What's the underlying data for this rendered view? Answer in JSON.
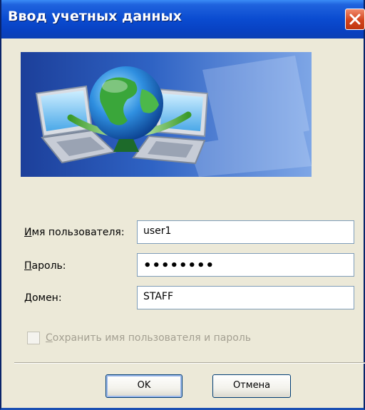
{
  "window": {
    "title": "Ввод учетных данных"
  },
  "icons": {
    "close": "close-icon",
    "banner": "network-globe-laptops-illustration"
  },
  "form": {
    "username": {
      "label_accel": "И",
      "label_rest": "мя пользователя:",
      "value": "user1"
    },
    "password": {
      "label_accel": "П",
      "label_rest": "ароль:",
      "value": "••••••••",
      "masked": true
    },
    "domain": {
      "label_accel": "Д",
      "label_rest": "омен:",
      "value": "STAFF"
    },
    "save_credentials": {
      "label_accel": "С",
      "label_rest": "охранить имя пользователя и пароль",
      "checked": false,
      "enabled": false
    }
  },
  "buttons": {
    "ok": "OK",
    "cancel": "Отмена"
  },
  "colors": {
    "titlebar": "#0a4bd0",
    "dialog_bg": "#ece9d8",
    "close_button": "#d3431c",
    "disabled_text": "#a4a092"
  }
}
